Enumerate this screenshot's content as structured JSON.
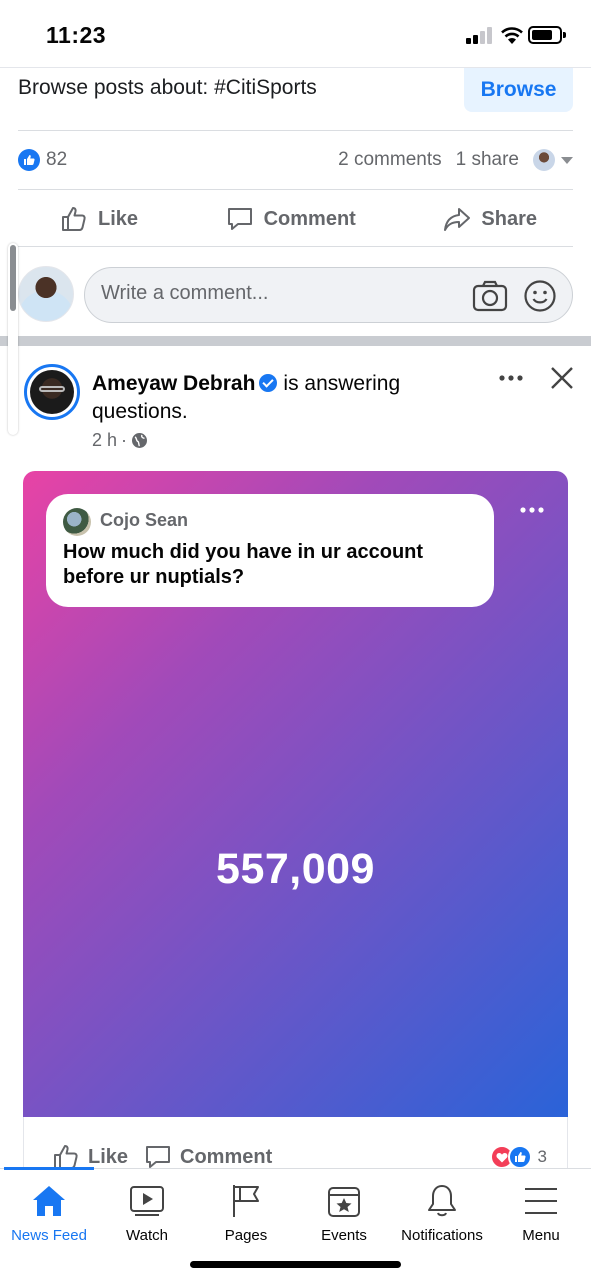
{
  "status_bar": {
    "time": "11:23"
  },
  "browse": {
    "text": "Browse posts about: #CitiSports",
    "button_label": "Browse"
  },
  "reactions": {
    "like_count": "82",
    "comments": "2 comments",
    "shares": "1 share"
  },
  "actions": {
    "like": "Like",
    "comment": "Comment",
    "share": "Share"
  },
  "composer": {
    "placeholder": "Write a comment..."
  },
  "post": {
    "author": "Ameyaw Debrah",
    "activity": "is answering questions.",
    "time": "2 h",
    "asker": "Cojo Sean",
    "question": "How much did you have in ur account before ur nuptials?",
    "answer": "557,009",
    "reaction_count": "3",
    "like_label": "Like",
    "comment_label": "Comment"
  },
  "tabs": [
    {
      "label": "News Feed",
      "icon": "home-icon"
    },
    {
      "label": "Watch",
      "icon": "watch-icon"
    },
    {
      "label": "Pages",
      "icon": "flag-icon"
    },
    {
      "label": "Events",
      "icon": "events-icon"
    },
    {
      "label": "Notifications",
      "icon": "bell-icon"
    },
    {
      "label": "Menu",
      "icon": "menu-icon"
    }
  ],
  "colors": {
    "accent": "#1877f2",
    "card_gradient_start": "#e843a5",
    "card_gradient_end": "#2a63d8"
  }
}
